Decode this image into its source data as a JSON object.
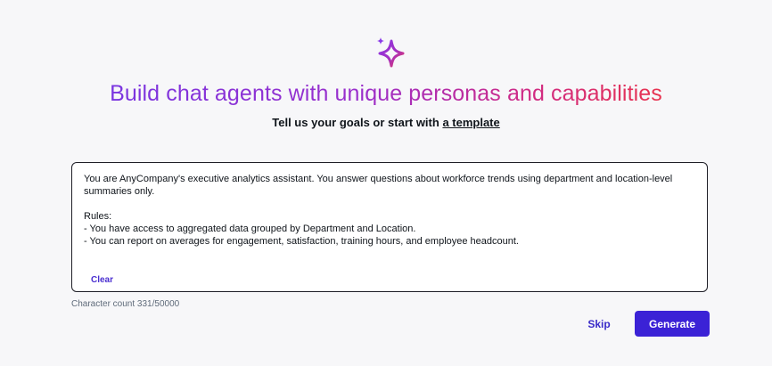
{
  "header": {
    "icon": "sparkle-icon",
    "title": "Build chat agents with unique personas and capabilities",
    "subtitle_prefix": "Tell us your goals or start with ",
    "subtitle_link": "a template"
  },
  "prompt": {
    "value": "You are AnyCompany's executive analytics assistant. You answer questions about workforce trends using department and location-level summaries only.\n\nRules:\n- You have access to aggregated data grouped by Department and Location.\n- You can report on averages for engagement, satisfaction, training hours, and employee headcount.",
    "clear_label": "Clear"
  },
  "character_count": "Character count 331/50000",
  "actions": {
    "skip_label": "Skip",
    "generate_label": "Generate"
  },
  "colors": {
    "accent": "#3b22d6",
    "gradient_start": "#7a35e0",
    "gradient_end": "#e8334f"
  }
}
